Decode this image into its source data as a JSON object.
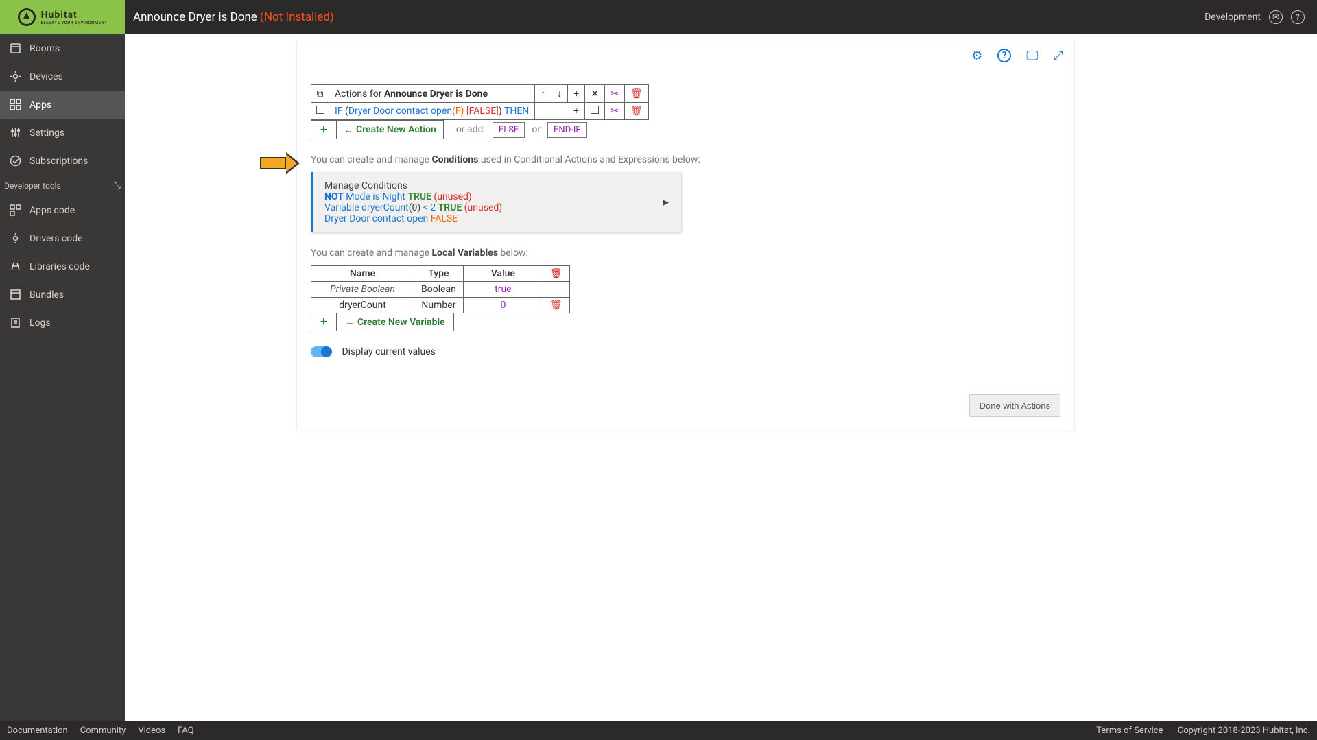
{
  "header": {
    "title": "Announce Dryer is Done",
    "status": "(Not Installed)",
    "dev_label": "Development"
  },
  "sidebar": {
    "items": [
      {
        "label": "Rooms"
      },
      {
        "label": "Devices"
      },
      {
        "label": "Apps"
      },
      {
        "label": "Settings"
      },
      {
        "label": "Subscriptions"
      }
    ],
    "section": "Developer tools",
    "dev_items": [
      {
        "label": "Apps code"
      },
      {
        "label": "Drivers code"
      },
      {
        "label": "Libraries code"
      },
      {
        "label": "Bundles"
      },
      {
        "label": "Logs"
      }
    ]
  },
  "actions": {
    "header_prefix": "Actions for ",
    "header_name": "Announce Dryer is Done",
    "row1": {
      "if": "IF ",
      "paren_open": "(",
      "cond": "Dryer Door contact open",
      "fval": "(F) ",
      "bracket": "[FALSE]",
      "paren_close": ")",
      "then": " THEN"
    },
    "create": "Create New Action",
    "or_add": "or add:",
    "else": "ELSE",
    "or": "or",
    "endif": "END-IF"
  },
  "conditions": {
    "intro1": "You can create and manage ",
    "bold": "Conditions",
    "intro2": " used in Conditional Actions and Expressions below:",
    "title": "Manage Conditions",
    "line1": {
      "not": "NOT",
      "text": " Mode is Night ",
      "true": "TRUE",
      "unused": " (unused)"
    },
    "line2": {
      "text": "Variable dryerCount",
      "zero": "(0) ",
      "op": "< 2 ",
      "true": "TRUE",
      "unused": " (unused)"
    },
    "line3": {
      "text": "Dryer Door contact open ",
      "false": "FALSE"
    }
  },
  "vars": {
    "intro1": "You can create and manage ",
    "bold": "Local Variables",
    "intro2": " below:",
    "headers": {
      "name": "Name",
      "type": "Type",
      "value": "Value"
    },
    "rows": [
      {
        "name": "Private Boolean",
        "type": "Boolean",
        "value": "true",
        "deletable": false,
        "italic": true
      },
      {
        "name": "dryerCount",
        "type": "Number",
        "value": "0",
        "deletable": true,
        "italic": false
      }
    ],
    "create": "Create New Variable"
  },
  "toggle_label": "Display current values",
  "done": "Done with Actions",
  "footer": {
    "links": [
      "Documentation",
      "Community",
      "Videos",
      "FAQ"
    ],
    "tos": "Terms of Service",
    "copy": "Copyright 2018-2023 Hubitat, Inc."
  }
}
